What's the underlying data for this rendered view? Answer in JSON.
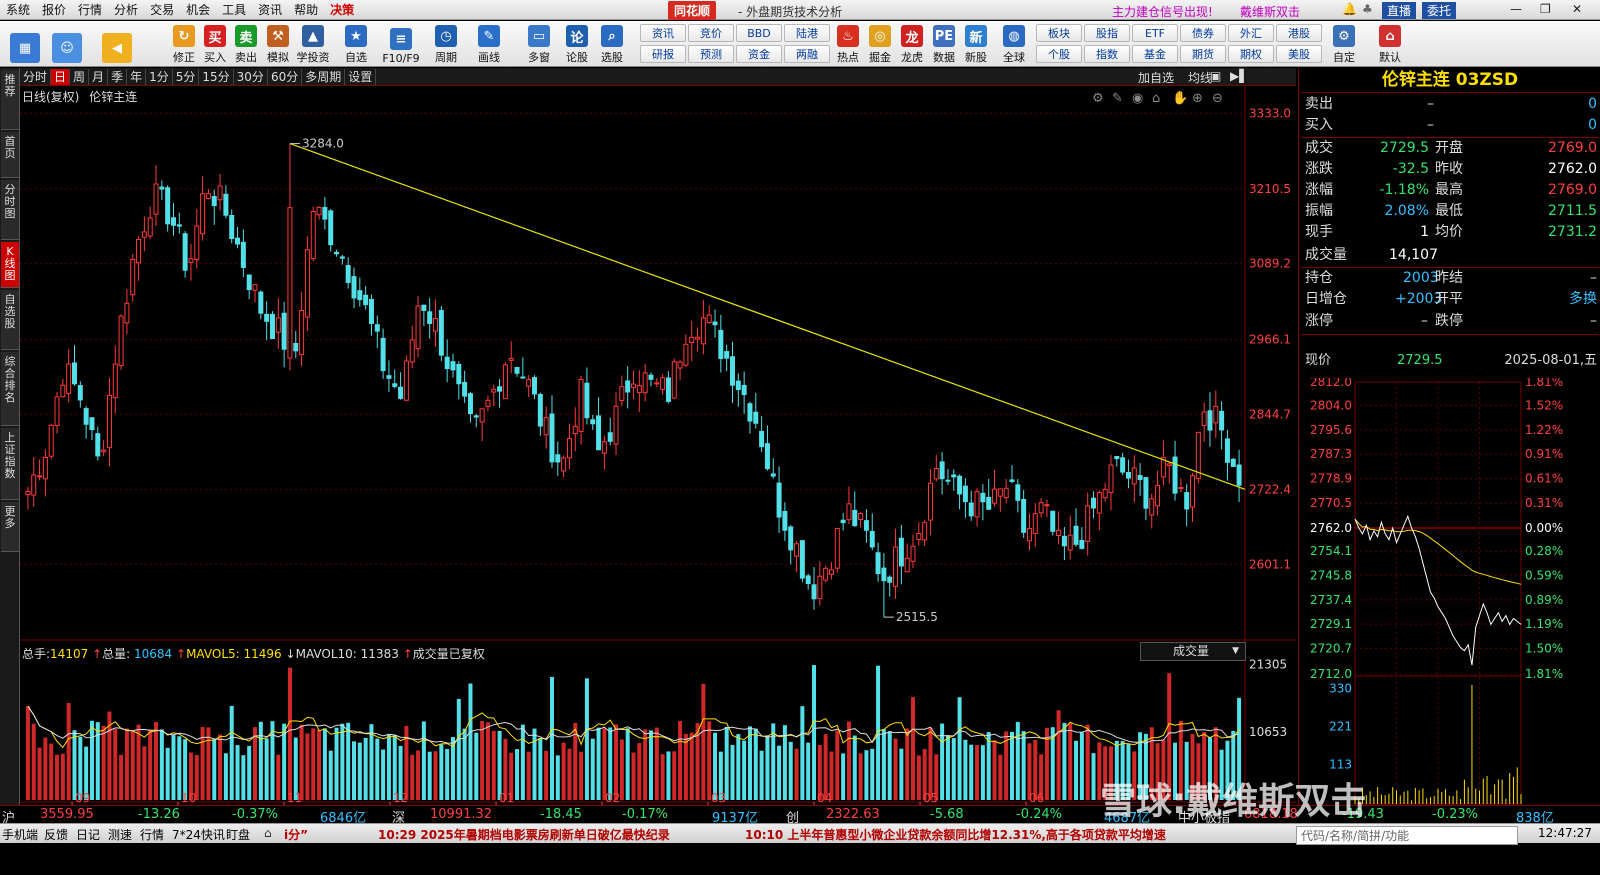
{
  "menubar": {
    "items": [
      "系统",
      "报价",
      "行情",
      "分析",
      "交易",
      "机会",
      "工具",
      "资讯",
      "帮助",
      "决策"
    ],
    "brand": "同花顺",
    "app_title": "- 外盘期货技术分析",
    "signal": "主力建仓信号出现!",
    "davis": "戴维斯双击",
    "live": "直播",
    "entrust": "委托"
  },
  "toolbar": {
    "buttons": [
      {
        "label": "",
        "icon": "grid-icon",
        "color": "#3a7bd5"
      },
      {
        "label": "",
        "icon": "robot-icon",
        "color": "#4a8fe0"
      },
      {
        "label": "",
        "icon": "back-arrow-icon",
        "color": "#f0b020"
      },
      {
        "label": "修正",
        "icon": "fix-icon",
        "color": "#e89a20"
      },
      {
        "label": "买入",
        "icon": "buy-icon",
        "color": "#d92020"
      },
      {
        "label": "卖出",
        "icon": "sell-icon",
        "color": "#1a9a2a"
      },
      {
        "label": "模拟",
        "icon": "hammer-icon",
        "color": "#c06020"
      },
      {
        "label": "学投资",
        "icon": "grad-cap-icon",
        "color": "#3060a0"
      },
      {
        "label": "自选",
        "icon": "star-icon",
        "color": "#2a6ac0"
      },
      {
        "label": "F10/F9",
        "icon": "f10-icon",
        "color": "#3070c0"
      },
      {
        "label": "周期",
        "icon": "clock-icon",
        "color": "#2060b0"
      },
      {
        "label": "画线",
        "icon": "pen-icon",
        "color": "#2a70c8"
      },
      {
        "label": "多窗",
        "icon": "window-icon",
        "color": "#3a78c8"
      },
      {
        "label": "论股",
        "icon": "discuss-icon",
        "color": "#1f5fb0"
      },
      {
        "label": "选股",
        "icon": "search-icon",
        "color": "#2a6ac0"
      }
    ],
    "small_buttons_top": [
      "资讯",
      "竞价",
      "BBD",
      "陆港"
    ],
    "small_buttons_bottom": [
      "研报",
      "预测",
      "资金",
      "两融"
    ],
    "buttons2": [
      {
        "label": "热点",
        "icon": "hot-icon",
        "color": "#d83020"
      },
      {
        "label": "掘金",
        "icon": "gold-icon",
        "color": "#e0a020"
      },
      {
        "label": "龙虎",
        "icon": "dragon-icon",
        "color": "#d02020"
      },
      {
        "label": "数据",
        "icon": "pe-icon",
        "color": "#4070c0"
      },
      {
        "label": "新股",
        "icon": "ipo-icon",
        "color": "#3080d0"
      },
      {
        "label": "全球",
        "icon": "globe-icon",
        "color": "#2a6ac0"
      }
    ],
    "small2_top": [
      "板块",
      "股指",
      "ETF",
      "债券",
      "外汇",
      "港股"
    ],
    "small2_bottom": [
      "个股",
      "指数",
      "基金",
      "期货",
      "期权",
      "美股"
    ],
    "buttons3": [
      {
        "label": "自定",
        "icon": "custom-icon",
        "color": "#3a70b8"
      },
      {
        "label": "默认",
        "icon": "home-icon",
        "color": "#d03030"
      }
    ]
  },
  "left_tabs": [
    "推荐",
    "首页",
    "分时图",
    "K线图",
    "自选股",
    "综合排名",
    "上证指数",
    "更多"
  ],
  "period_bar": {
    "items": [
      "分时",
      "日",
      "周",
      "月",
      "季",
      "年",
      "1分",
      "5分",
      "15分",
      "30分",
      "60分",
      "多周期",
      "设置"
    ],
    "active": "日",
    "right_items": [
      "加自选",
      "均线"
    ]
  },
  "chart_head": {
    "mode": "日线(复权)",
    "name": "伦锌主连"
  },
  "chart_data": [
    {
      "type": "candlestick",
      "title": "伦锌主连 日线(复权)",
      "x_month_labels": [
        "09",
        "10",
        "11",
        "12",
        "01",
        "02",
        "03",
        "04",
        "05",
        "06"
      ],
      "ylim": [
        2480,
        3345
      ],
      "y_ticks": [
        3333.0,
        3210.5,
        3089.2,
        2966.1,
        2844.7,
        2722.4,
        2601.1
      ],
      "y_ticks_text": [
        "3333.0",
        "3210.5",
        "3089.2",
        "2966.1",
        "2844.7",
        "2722.4",
        "2601.1"
      ],
      "annotations": [
        {
          "label": "3284.0",
          "value": 3284.0
        },
        {
          "label": "2515.5",
          "value": 2515.5
        }
      ],
      "trendline": {
        "from": 3284.0,
        "to": 2723.0,
        "color": "#e6e600"
      },
      "anchors": [
        2720,
        2790,
        2920,
        2870,
        2760,
        2960,
        3110,
        3200,
        3170,
        3080,
        3220,
        3180,
        3100,
        3020,
        2980,
        2940,
        3180,
        3140,
        3080,
        3010,
        2920,
        2870,
        3040,
        2980,
        2890,
        2810,
        2870,
        2950,
        2900,
        2820,
        2760,
        2880,
        2780,
        2840,
        2920,
        2890,
        2880,
        2990,
        3000,
        2950,
        2890,
        2830,
        2710,
        2640,
        2560,
        2610,
        2690,
        2650,
        2580,
        2620,
        2660,
        2760,
        2720,
        2700,
        2690,
        2730,
        2650,
        2690,
        2620,
        2640,
        2700,
        2760,
        2740,
        2710,
        2760,
        2700,
        2860,
        2820,
        2740
      ]
    },
    {
      "type": "bar",
      "title": "成交量",
      "y_ticks": [
        21305,
        10653
      ],
      "y_ticks_text": [
        "21305",
        "10653"
      ],
      "ylim": [
        0,
        22000
      ],
      "series": [
        {
          "name": "MAVOL5"
        },
        {
          "name": "MAVOL10"
        }
      ]
    },
    {
      "type": "line",
      "title": "伦锌主连 03ZSD 分时",
      "ylim": [
        2712.0,
        2812.0
      ],
      "y_ticks": [
        2812.0,
        2804.0,
        2795.6,
        2787.3,
        2778.9,
        2770.5,
        2762.0,
        2754.1,
        2745.8,
        2737.4,
        2729.1,
        2720.7,
        2712.0
      ],
      "y_ticks_text": [
        "2812.0",
        "2804.0",
        "2795.6",
        "2787.3",
        "2778.9",
        "2770.5",
        "2762.0",
        "2754.1",
        "2745.8",
        "2737.4",
        "2729.1",
        "2720.7",
        "2712.0"
      ],
      "pct_ticks": [
        "1.81%",
        "1.52%",
        "1.22%",
        "0.91%",
        "0.61%",
        "0.31%",
        "0.00%",
        "0.28%",
        "0.59%",
        "0.89%",
        "1.19%",
        "1.50%",
        "1.81%"
      ],
      "prev_close": 2762.0,
      "vol_ticks": [
        "330",
        "221",
        "113"
      ],
      "price": [
        2765,
        2762,
        2760,
        2763,
        2758,
        2761,
        2759,
        2764,
        2760,
        2758,
        2762,
        2757,
        2760,
        2763,
        2766,
        2762,
        2759,
        2755,
        2750,
        2745,
        2740,
        2738,
        2735,
        2733,
        2731,
        2728,
        2725,
        2723,
        2721,
        2720,
        2722,
        2715,
        2728,
        2732,
        2736,
        2733,
        2729,
        2731,
        2733,
        2730,
        2732,
        2729,
        2731,
        2730,
        2729
      ]
    }
  ],
  "vol_head": {
    "total_label": "总手:",
    "total": "14107",
    "vol_label": "总量:",
    "vol": "10684",
    "ma5_label": "MAVOL5:",
    "ma5": "11496",
    "ma10_label": "MAVOL10:",
    "ma10": "11383",
    "note": "成交量已复权",
    "selector": "成交量"
  },
  "quote": {
    "title": "伦锌主连 03ZSD",
    "sell_label": "卖出",
    "sell": "–",
    "sell_v": "0",
    "buy_label": "买入",
    "buy": "–",
    "buy_v": "0",
    "rows": [
      {
        "l1": "成交",
        "v1": "2729.5",
        "c1": "#35e36d",
        "l2": "开盘",
        "v2": "2769.0",
        "c2": "#ff4040"
      },
      {
        "l1": "涨跌",
        "v1": "-32.5",
        "c1": "#35e36d",
        "l2": "昨收",
        "v2": "2762.0",
        "c2": "#ffffff"
      },
      {
        "l1": "涨幅",
        "v1": "-1.18%",
        "c1": "#35e36d",
        "l2": "最高",
        "v2": "2769.0",
        "c2": "#ff4040"
      },
      {
        "l1": "振幅",
        "v1": "2.08%",
        "c1": "#33c0ff",
        "l2": "最低",
        "v2": "2711.5",
        "c2": "#35e36d"
      },
      {
        "l1": "现手",
        "v1": "1",
        "c1": "#ffffff",
        "l2": "均价",
        "v2": "2731.2",
        "c2": "#35e36d"
      }
    ],
    "volume_label": "成交量",
    "volume": "14,107",
    "oi_label": "持仓",
    "oi": "2003",
    "settle_label": "昨结",
    "settle": "–",
    "daily_label": "日增仓",
    "daily": "+2003",
    "open_label": "开平",
    "open_val": "多换",
    "limitup_label": "涨停",
    "limitup": "–",
    "limitdown_label": "跌停",
    "limitdown": "–",
    "now_label": "现价",
    "now": "2729.5",
    "date": "2025-08-01,五"
  },
  "status": [
    {
      "t": "沪",
      "c": "#ddd"
    },
    {
      "t": "3559.95",
      "c": "#ff4040"
    },
    {
      "t": "-13.26",
      "c": "#35e36d"
    },
    {
      "t": "-0.37%",
      "c": "#35e36d"
    },
    {
      "t": "6846亿",
      "c": "#33c0ff"
    },
    {
      "t": "深",
      "c": "#ddd"
    },
    {
      "t": "10991.32",
      "c": "#ff4040"
    },
    {
      "t": "-18.45",
      "c": "#35e36d"
    },
    {
      "t": "-0.17%",
      "c": "#35e36d"
    },
    {
      "t": "9137亿",
      "c": "#33c0ff"
    },
    {
      "t": "创",
      "c": "#ddd"
    },
    {
      "t": "2322.63",
      "c": "#ff4040"
    },
    {
      "t": "-5.68",
      "c": "#35e36d"
    },
    {
      "t": "-0.24%",
      "c": "#35e36d"
    },
    {
      "t": "4687亿",
      "c": "#33c0ff"
    },
    {
      "t": "中小板指",
      "c": "#ddd"
    },
    {
      "t": "6818.18",
      "c": "#ff4040"
    },
    {
      "t": "-19.43",
      "c": "#35e36d"
    },
    {
      "t": "-0.23%",
      "c": "#35e36d"
    },
    {
      "t": "838亿",
      "c": "#33c0ff"
    }
  ],
  "bottom": {
    "items": [
      "手机端",
      "反馈",
      "日记",
      "测速",
      "行情",
      "7*24快讯",
      "盯盘"
    ],
    "score": "i分”",
    "news1": "10:29 2025年暑期档电影票房刷新单日破亿最快纪录",
    "news2": "10:10 上半年普惠型小微企业贷款余额同比增12.31%,高于各项贷款平均增速",
    "search": "代码/名称/简拼/功能",
    "time": "12:47:27"
  },
  "watermark": "雪球:戴维斯双击"
}
